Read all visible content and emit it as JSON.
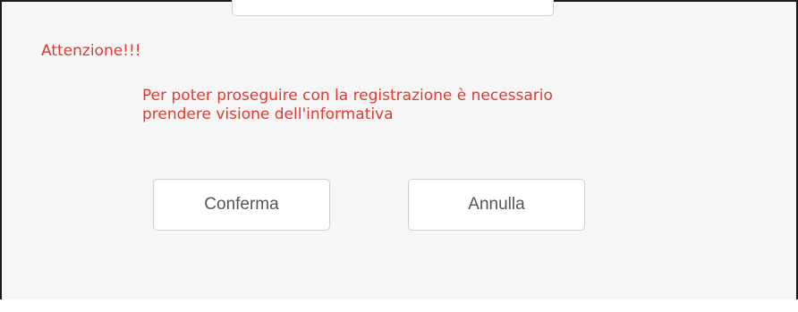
{
  "dialog": {
    "title": "Attenzione!!!",
    "message": "Per poter proseguire con la registrazione è necessario\nprendere visione dell'informativa",
    "buttons": {
      "confirm_label": "Conferma",
      "cancel_label": "Annulla"
    }
  },
  "colors": {
    "warning_text": "#e03a2f",
    "button_text": "#555555",
    "dialog_background": "#f6f6f6"
  }
}
